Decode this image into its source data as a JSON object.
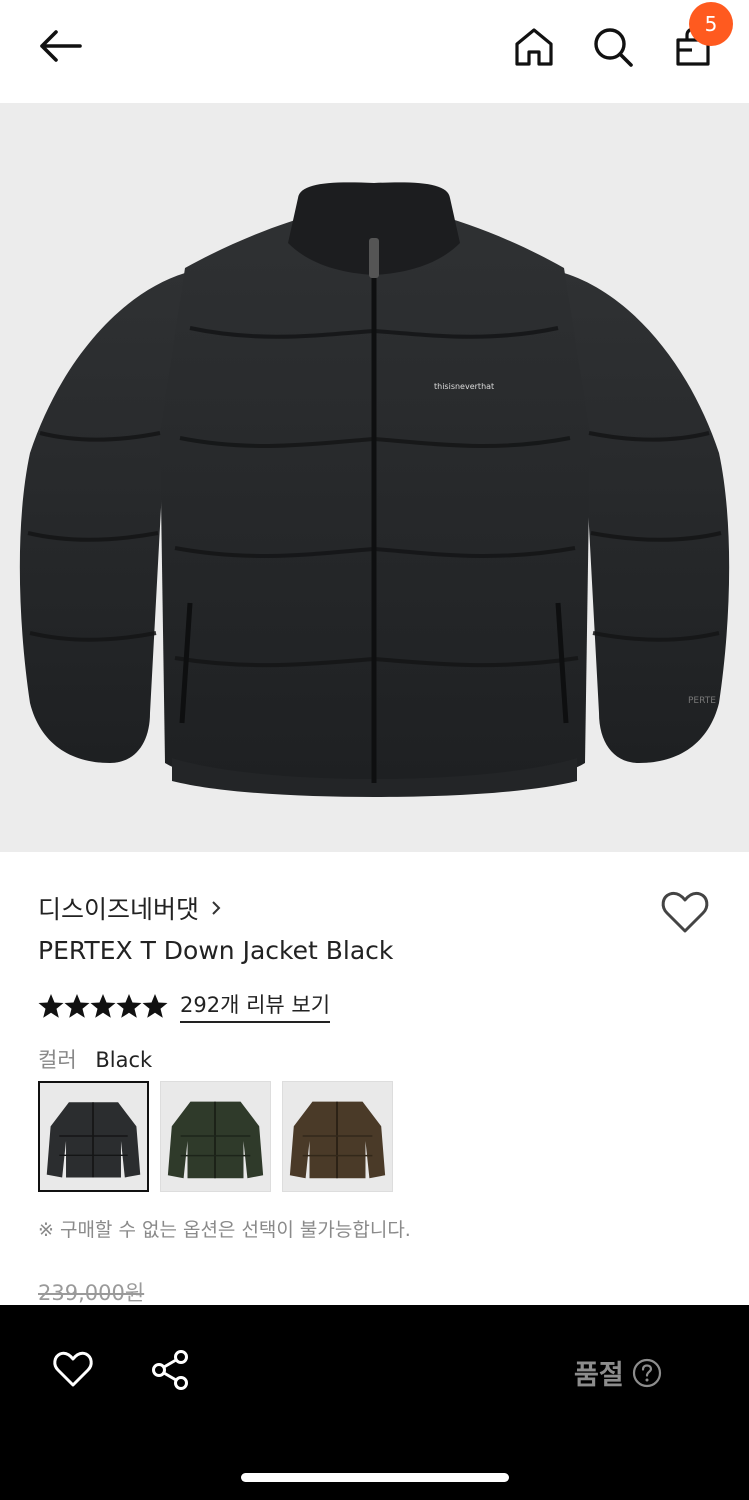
{
  "header": {
    "back_icon": "arrow-left-icon",
    "home_icon": "home-icon",
    "search_icon": "search-icon",
    "bag_icon": "shopping-bag-icon",
    "cart_count": "5",
    "badge_color": "#ff5a1f"
  },
  "product": {
    "image_alt": "black puffer down jacket",
    "brand": "디스이즈네버댓",
    "title": "PERTEX T Down Jacket Black",
    "rating_stars": 5,
    "review_link": "292개 리뷰 보기",
    "color_label": "컬러",
    "color_value": "Black",
    "swatches": [
      {
        "name": "Black",
        "color": "#2b2d2f",
        "selected": true
      },
      {
        "name": "Khaki",
        "color": "#2f3a2a",
        "selected": false
      },
      {
        "name": "Brown",
        "color": "#4a3a28",
        "selected": false
      }
    ],
    "notice": "※ 구매할 수 없는 옵션은 선택이 불가능합니다.",
    "price_original": "239,000원"
  },
  "bottom_bar": {
    "wish_icon": "heart-outline-icon",
    "share_icon": "share-icon",
    "status": "품절",
    "help_icon": "question-circle-icon"
  }
}
